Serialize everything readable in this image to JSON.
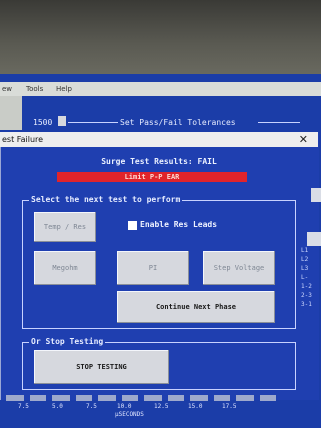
{
  "menubar": {
    "item1": "ew",
    "item2": "Tools",
    "item3": "Help"
  },
  "topbar": {
    "value": "1500",
    "group_title": "Set Pass/Fail Tolerances"
  },
  "dialog": {
    "title": "est Failure",
    "results_label": "Surge Test Results:  FAIL",
    "fail_reason": "Limit P-P EAR",
    "next_test_group": "Select the next test to perform",
    "buttons": {
      "temp_res": "Temp / Res",
      "megohm": "Megohm",
      "pi": "PI",
      "step_voltage": "Step Voltage",
      "continue": "Continue Next Phase",
      "stop": "STOP TESTING"
    },
    "checkbox": {
      "label": "Enable Res Leads",
      "checked": true
    },
    "stop_group": "Or Stop Testing"
  },
  "right_labels": [
    "L1",
    "L2",
    "L3",
    "L-",
    "1-2",
    "2-3",
    "3-1"
  ],
  "axis": {
    "ticks": [
      "7.5",
      "5.0",
      "7.5",
      "10.0",
      "12.5",
      "15.0",
      "17.5"
    ],
    "unit": "μSECONDS"
  },
  "colors": {
    "screen": "#1f3fb0",
    "fail": "#e0242b",
    "button": "#d6d8de"
  }
}
